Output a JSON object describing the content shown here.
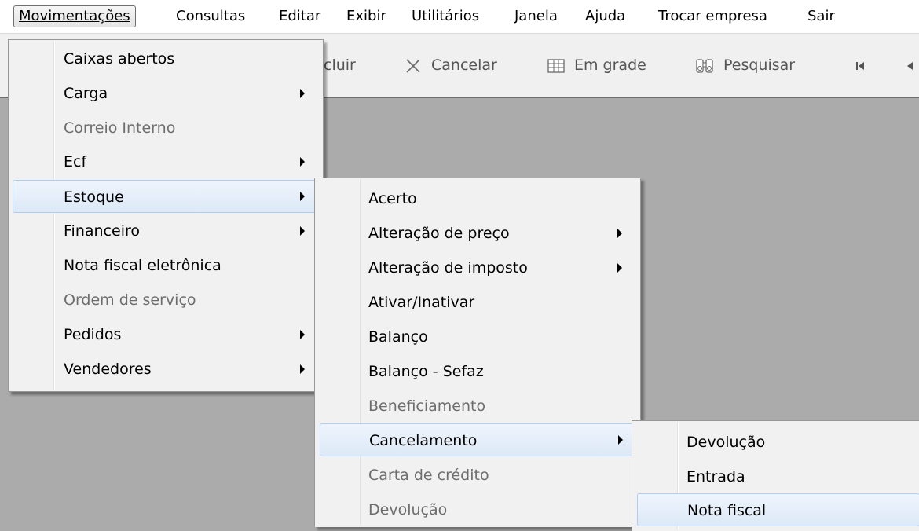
{
  "menubar": {
    "items": [
      {
        "label": "Movimentações",
        "active": true
      },
      {
        "label": "Consultas"
      },
      {
        "label": "Editar"
      },
      {
        "label": "Exibir"
      },
      {
        "label": "Utilitários"
      },
      {
        "label": "Janela"
      },
      {
        "label": "Ajuda"
      },
      {
        "label": "Trocar empresa"
      },
      {
        "label": "Sair"
      }
    ]
  },
  "toolbar": {
    "partial_label": "cluir",
    "cancel_label": "Cancelar",
    "grid_label": "Em grade",
    "search_label": "Pesquisar"
  },
  "menu1": {
    "items": [
      {
        "label": "Caixas abertos"
      },
      {
        "label": "Carga",
        "submenu": true
      },
      {
        "label": "Correio Interno",
        "disabled": true
      },
      {
        "label": "Ecf",
        "submenu": true
      },
      {
        "label": "Estoque",
        "submenu": true,
        "highlighted": true
      },
      {
        "label": "Financeiro",
        "submenu": true
      },
      {
        "label": "Nota fiscal eletrônica"
      },
      {
        "label": "Ordem de serviço",
        "disabled": true
      },
      {
        "label": "Pedidos",
        "submenu": true
      },
      {
        "label": "Vendedores",
        "submenu": true
      }
    ]
  },
  "menu2": {
    "items": [
      {
        "label": "Acerto"
      },
      {
        "label": "Alteração de preço",
        "submenu": true
      },
      {
        "label": "Alteração de imposto",
        "submenu": true
      },
      {
        "label": "Ativar/Inativar"
      },
      {
        "label": "Balanço"
      },
      {
        "label": "Balanço - Sefaz"
      },
      {
        "label": "Beneficiamento",
        "disabled": true
      },
      {
        "label": "Cancelamento",
        "submenu": true,
        "highlighted": true
      },
      {
        "label": "Carta de crédito",
        "disabled": true
      },
      {
        "label": "Devolução",
        "disabled": true
      }
    ]
  },
  "menu3": {
    "items": [
      {
        "label": "Devolução"
      },
      {
        "label": "Entrada"
      },
      {
        "label": "Nota fiscal",
        "highlighted": true
      }
    ]
  },
  "colors": {
    "workspace": "#ababab",
    "menu_bg": "#f1f1f1",
    "highlight_border": "#aecdf0",
    "disabled_text": "#6d6d6d"
  }
}
